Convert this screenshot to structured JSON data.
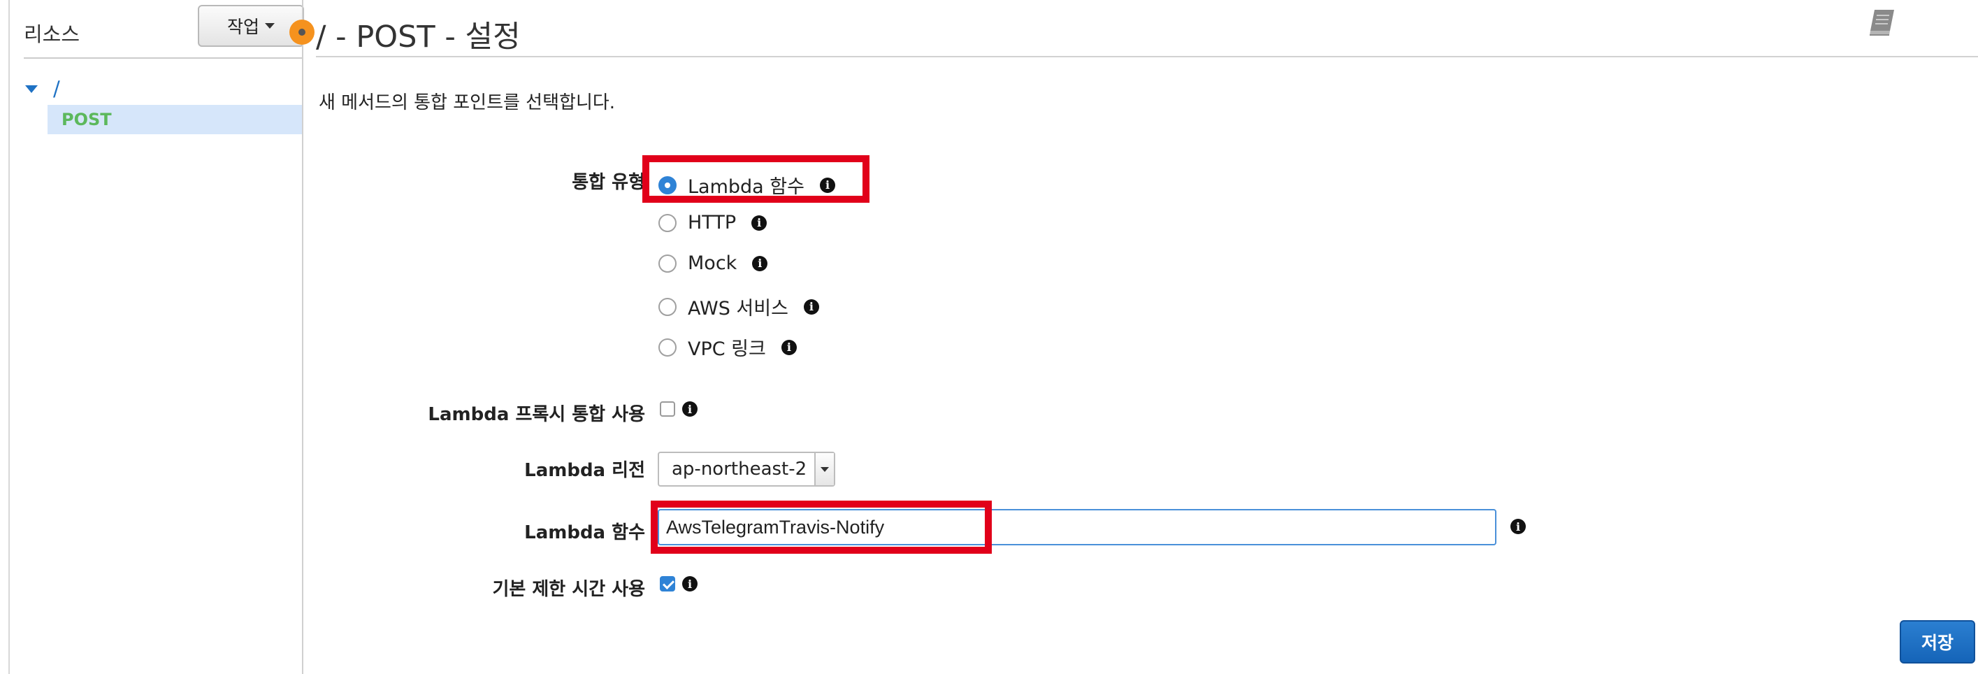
{
  "left_panel": {
    "title": "리소스",
    "actions_label": "작업",
    "tree": {
      "root_label": "/",
      "children": [
        {
          "label": "POST",
          "selected": true
        }
      ]
    }
  },
  "main": {
    "title": "/ - POST - 설정",
    "instruction": "새 메서드의 통합 포인트를 선택합니다.",
    "integration_type": {
      "label": "통합 유형",
      "options": [
        {
          "label": "Lambda 함수",
          "selected": true
        },
        {
          "label": "HTTP",
          "selected": false
        },
        {
          "label": "Mock",
          "selected": false
        },
        {
          "label": "AWS 서비스",
          "selected": false
        },
        {
          "label": "VPC 링크",
          "selected": false
        }
      ]
    },
    "lambda_proxy": {
      "label": "Lambda 프록시 통합 사용",
      "checked": false
    },
    "lambda_region": {
      "label": "Lambda 리전",
      "value": "ap-northeast-2"
    },
    "lambda_function": {
      "label": "Lambda 함수",
      "value": "AwsTelegramTravis-Notify"
    },
    "default_timeout": {
      "label": "기본 제한 시간 사용",
      "checked": true
    },
    "save_label": "저장"
  },
  "colors": {
    "accent_blue": "#2f83d6",
    "highlight_red": "#e1001a",
    "tree_green": "#5cb85c",
    "status_orange": "#f5921e",
    "save_button": "#1f6fc4"
  },
  "icons": [
    "info-icon",
    "book-icon",
    "chevron-down-icon",
    "tree-expand-icon",
    "status-dot-icon"
  ]
}
